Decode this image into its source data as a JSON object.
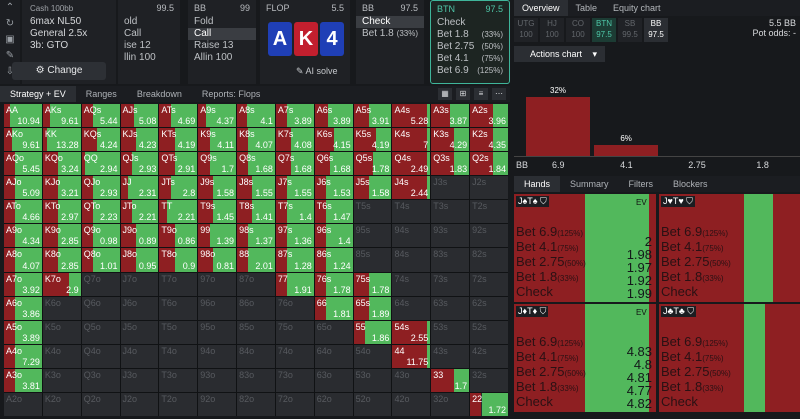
{
  "sidebar_icons": [
    "chevron-up-icon",
    "refresh-icon",
    "save-icon",
    "edit-icon",
    "export-icon"
  ],
  "game": {
    "title": "Cash 100",
    "title_unit": "bb",
    "lines": [
      "6max NL50",
      "General 2.5x",
      "3b: GTO"
    ],
    "change_label": "Change"
  },
  "panel_sb": {
    "pos": "",
    "stack": "99.5",
    "rows": [
      {
        "a": "old",
        "p": ""
      },
      {
        "a": "Call",
        "p": ""
      },
      {
        "a": "ise 12",
        "p": ""
      },
      {
        "a": "llin 100",
        "p": ""
      }
    ]
  },
  "panel_bb": {
    "pos": "BB",
    "stack": "99",
    "rows": [
      {
        "a": "Fold",
        "p": ""
      },
      {
        "a": "Call",
        "p": ""
      },
      {
        "a": "Raise 13",
        "p": ""
      },
      {
        "a": "Allin 100",
        "p": ""
      }
    ]
  },
  "flop": {
    "label": "FLOP",
    "pot": "5.5",
    "cards": [
      "A",
      "K",
      "4"
    ],
    "ai_label": "AI solve"
  },
  "panel_bb2": {
    "pos": "BB",
    "stack": "97.5",
    "rows": [
      {
        "a": "Check",
        "p": ""
      },
      {
        "a": "Bet 1.8",
        "p": "(33%)"
      }
    ]
  },
  "panel_btn": {
    "pos": "BTN",
    "stack": "97.5",
    "rows": [
      {
        "a": "Check",
        "p": ""
      },
      {
        "a": "Bet 1.8",
        "p": "(33%)"
      },
      {
        "a": "Bet 2.75",
        "p": "(50%)"
      },
      {
        "a": "Bet 4.1",
        "p": "(75%)"
      },
      {
        "a": "Bet 6.9",
        "p": "(125%)"
      }
    ]
  },
  "subnav": {
    "tabs": [
      "Strategy + EV",
      "Ranges",
      "Breakdown",
      "Reports: Flops"
    ]
  },
  "grid": [
    [
      [
        "AA",
        "10.94",
        0.15,
        0.85
      ],
      [
        "AKs",
        "9.61",
        0.2,
        0.8
      ],
      [
        "AQs",
        "5.44",
        0.3,
        0.7
      ],
      [
        "AJs",
        "5.08",
        0.35,
        0.65
      ],
      [
        "ATs",
        "4.69",
        0.3,
        0.7
      ],
      [
        "A9s",
        "4.37",
        0.2,
        0.8
      ],
      [
        "A8s",
        "4.1",
        0.25,
        0.75
      ],
      [
        "A7s",
        "3.89",
        0.3,
        0.7
      ],
      [
        "A6s",
        "3.89",
        0.35,
        0.65
      ],
      [
        "A5s",
        "3.91",
        0.4,
        0.6
      ],
      [
        "A4s",
        "5.28",
        0.9,
        0.1
      ],
      [
        "A3s",
        "3.87",
        0.5,
        0.5
      ],
      [
        "A2s",
        "3.96",
        0.6,
        0.4
      ]
    ],
    [
      [
        "AKo",
        "9.61",
        0.2,
        0.8
      ],
      [
        "KK",
        "13.28",
        0.1,
        0.9
      ],
      [
        "KQs",
        "4.24",
        0.4,
        0.6
      ],
      [
        "KJs",
        "4.23",
        0.4,
        0.6
      ],
      [
        "KTs",
        "4.19",
        0.4,
        0.6
      ],
      [
        "K9s",
        "4.11",
        0.3,
        0.7
      ],
      [
        "K8s",
        "4.07",
        0.3,
        0.7
      ],
      [
        "K7s",
        "4.08",
        0.4,
        0.6
      ],
      [
        "K6s",
        "4.15",
        0.5,
        0.5
      ],
      [
        "K5s",
        "4.19",
        0.6,
        0.4
      ],
      [
        "K4s",
        "7",
        0.9,
        0.1
      ],
      [
        "K3s",
        "4.29",
        0.6,
        0.4
      ],
      [
        "K2s",
        "4.35",
        0.6,
        0.4
      ]
    ],
    [
      [
        "AQo",
        "5.45",
        0.3,
        0.7
      ],
      [
        "KQo",
        "3.24",
        0.4,
        0.6
      ],
      [
        "QQ",
        "2.94",
        0.1,
        0.9
      ],
      [
        "QJs",
        "2.93",
        0.3,
        0.7
      ],
      [
        "QTs",
        "2.91",
        0.4,
        0.6
      ],
      [
        "Q9s",
        "1.7",
        0.3,
        0.7
      ],
      [
        "Q8s",
        "1.68",
        0.3,
        0.7
      ],
      [
        "Q7s",
        "1.68",
        0.4,
        0.6
      ],
      [
        "Q6s",
        "1.68",
        0.4,
        0.6
      ],
      [
        "Q5s",
        "1.78",
        0.5,
        0.5
      ],
      [
        "Q4s",
        "2.49",
        0.9,
        0.1
      ],
      [
        "Q3s",
        "1.83",
        0.6,
        0.4
      ],
      [
        "Q2s",
        "1.84",
        0.6,
        0.4
      ]
    ],
    [
      [
        "AJo",
        "5.09",
        0.3,
        0.7
      ],
      [
        "KJo",
        "3.21",
        0.4,
        0.6
      ],
      [
        "QJo",
        "2.93",
        0.3,
        0.7
      ],
      [
        "JJ",
        "2.31",
        0.2,
        0.8
      ],
      [
        "JTs",
        "2.8",
        0.3,
        0.7
      ],
      [
        "J9s",
        "1.58",
        0.4,
        0.6
      ],
      [
        "J8s",
        "1.55",
        0.4,
        0.6
      ],
      [
        "J7s",
        "1.55",
        0.3,
        0.7
      ],
      [
        "J6s",
        "1.53",
        0.3,
        0.7
      ],
      [
        "J5s",
        "1.58",
        0.4,
        0.6
      ],
      [
        "J4s",
        "2.44",
        0.9,
        0.1
      ],
      [
        "J3s",
        "",
        0,
        0
      ],
      [
        "J2s",
        "",
        0,
        0
      ]
    ],
    [
      [
        "ATo",
        "4.66",
        0.3,
        0.7
      ],
      [
        "KTo",
        "2.97",
        0.4,
        0.6
      ],
      [
        "QTo",
        "2.23",
        0.3,
        0.7
      ],
      [
        "JTo",
        "2.21",
        0.3,
        0.7
      ],
      [
        "TT",
        "2.21",
        0.2,
        0.8
      ],
      [
        "T9s",
        "1.45",
        0.4,
        0.6
      ],
      [
        "T8s",
        "1.41",
        0.4,
        0.6
      ],
      [
        "T7s",
        "1.4",
        0.3,
        0.7
      ],
      [
        "T6s",
        "1.47",
        0.3,
        0.7
      ],
      [
        "T5s",
        "",
        0,
        0
      ],
      [
        "T4s",
        "",
        0,
        0
      ],
      [
        "T3s",
        "",
        0,
        0
      ],
      [
        "T2s",
        "",
        0,
        0
      ]
    ],
    [
      [
        "A9o",
        "4.34",
        0.3,
        0.7
      ],
      [
        "K9o",
        "2.85",
        0.4,
        0.6
      ],
      [
        "Q9o",
        "0.98",
        0.3,
        0.7
      ],
      [
        "J9o",
        "0.89",
        0.4,
        0.6
      ],
      [
        "T9o",
        "0.86",
        0.4,
        0.6
      ],
      [
        "99",
        "1.39",
        0.3,
        0.7
      ],
      [
        "98s",
        "1.37",
        0.3,
        0.7
      ],
      [
        "97s",
        "1.36",
        0.3,
        0.7
      ],
      [
        "96s",
        "1.4",
        0.3,
        0.7
      ],
      [
        "95s",
        "",
        0,
        0
      ],
      [
        "94s",
        "",
        0,
        0
      ],
      [
        "93s",
        "",
        0,
        0
      ],
      [
        "92s",
        "",
        0,
        0
      ]
    ],
    [
      [
        "A8o",
        "4.07",
        0.3,
        0.7
      ],
      [
        "K8o",
        "2.85",
        0.4,
        0.6
      ],
      [
        "Q8o",
        "1.01",
        0.3,
        0.7
      ],
      [
        "J8o",
        "0.95",
        0.4,
        0.6
      ],
      [
        "T8o",
        "0.9",
        0.4,
        0.6
      ],
      [
        "98o",
        "0.81",
        0.4,
        0.6
      ],
      [
        "88",
        "2.01",
        0.3,
        0.7
      ],
      [
        "87s",
        "1.28",
        0.3,
        0.7
      ],
      [
        "86s",
        "1.24",
        0.3,
        0.7
      ],
      [
        "85s",
        "",
        0,
        0
      ],
      [
        "84s",
        "",
        0,
        0
      ],
      [
        "83s",
        "",
        0,
        0
      ],
      [
        "82s",
        "",
        0,
        0
      ]
    ],
    [
      [
        "A7o",
        "3.92",
        0.3,
        0.7
      ],
      [
        "K7o",
        "2.9",
        0.7,
        0.3
      ],
      [
        "Q7o",
        "",
        0,
        0
      ],
      [
        "J7o",
        "",
        0,
        0
      ],
      [
        "T7o",
        "",
        0,
        0
      ],
      [
        "97o",
        "",
        0,
        0
      ],
      [
        "87o",
        "",
        0,
        0
      ],
      [
        "77",
        "1.91",
        0.3,
        0.7
      ],
      [
        "76s",
        "1.78",
        0.3,
        0.7
      ],
      [
        "75s",
        "1.78",
        0.4,
        0.6
      ],
      [
        "74s",
        "",
        0,
        0
      ],
      [
        "73s",
        "",
        0,
        0
      ],
      [
        "72s",
        "",
        0,
        0
      ]
    ],
    [
      [
        "A6o",
        "3.86",
        0.3,
        0.7
      ],
      [
        "K6o",
        "",
        0,
        0
      ],
      [
        "Q6o",
        "",
        0,
        0
      ],
      [
        "J6o",
        "",
        0,
        0
      ],
      [
        "T6o",
        "",
        0,
        0
      ],
      [
        "96o",
        "",
        0,
        0
      ],
      [
        "86o",
        "",
        0,
        0
      ],
      [
        "76o",
        "",
        0,
        0
      ],
      [
        "66",
        "1.81",
        0.3,
        0.7
      ],
      [
        "65s",
        "1.89",
        0.4,
        0.6
      ],
      [
        "64s",
        "",
        0,
        0
      ],
      [
        "63s",
        "",
        0,
        0
      ],
      [
        "62s",
        "",
        0,
        0
      ]
    ],
    [
      [
        "A5o",
        "3.89",
        0.3,
        0.7
      ],
      [
        "K5o",
        "",
        0,
        0
      ],
      [
        "Q5o",
        "",
        0,
        0
      ],
      [
        "J5o",
        "",
        0,
        0
      ],
      [
        "T5o",
        "",
        0,
        0
      ],
      [
        "95o",
        "",
        0,
        0
      ],
      [
        "85o",
        "",
        0,
        0
      ],
      [
        "75o",
        "",
        0,
        0
      ],
      [
        "65o",
        "",
        0,
        0
      ],
      [
        "55",
        "1.86",
        0.3,
        0.7
      ],
      [
        "54s",
        "2.55",
        0.9,
        0.1
      ],
      [
        "53s",
        "",
        0,
        0
      ],
      [
        "52s",
        "",
        0,
        0
      ]
    ],
    [
      [
        "A4o",
        "7.29",
        0.3,
        0.7
      ],
      [
        "K4o",
        "",
        0,
        0
      ],
      [
        "Q4o",
        "",
        0,
        0
      ],
      [
        "J4o",
        "",
        0,
        0
      ],
      [
        "T4o",
        "",
        0,
        0
      ],
      [
        "94o",
        "",
        0,
        0
      ],
      [
        "84o",
        "",
        0,
        0
      ],
      [
        "74o",
        "",
        0,
        0
      ],
      [
        "64o",
        "",
        0,
        0
      ],
      [
        "54o",
        "",
        0,
        0
      ],
      [
        "44",
        "11.75",
        0.9,
        0.1
      ],
      [
        "43s",
        "",
        0,
        0
      ],
      [
        "42s",
        "",
        0,
        0
      ]
    ],
    [
      [
        "A3o",
        "3.81",
        0.3,
        0.7
      ],
      [
        "K3o",
        "",
        0,
        0
      ],
      [
        "Q3o",
        "",
        0,
        0
      ],
      [
        "J3o",
        "",
        0,
        0
      ],
      [
        "T3o",
        "",
        0,
        0
      ],
      [
        "93o",
        "",
        0,
        0
      ],
      [
        "83o",
        "",
        0,
        0
      ],
      [
        "73o",
        "",
        0,
        0
      ],
      [
        "63o",
        "",
        0,
        0
      ],
      [
        "53o",
        "",
        0,
        0
      ],
      [
        "43o",
        "",
        0,
        0
      ],
      [
        "33",
        "1.7",
        0.6,
        0.4
      ],
      [
        "32s",
        "",
        0,
        0
      ]
    ],
    [
      [
        "A2o",
        "",
        0,
        0
      ],
      [
        "K2o",
        "",
        0,
        0
      ],
      [
        "Q2o",
        "",
        0,
        0
      ],
      [
        "J2o",
        "",
        0,
        0
      ],
      [
        "T2o",
        "",
        0,
        0
      ],
      [
        "92o",
        "",
        0,
        0
      ],
      [
        "82o",
        "",
        0,
        0
      ],
      [
        "72o",
        "",
        0,
        0
      ],
      [
        "62o",
        "",
        0,
        0
      ],
      [
        "52o",
        "",
        0,
        0
      ],
      [
        "42o",
        "",
        0,
        0
      ],
      [
        "32o",
        "",
        0,
        0
      ],
      [
        "22",
        "1.72",
        0.3,
        0.7
      ]
    ]
  ],
  "right_tabs": [
    "Overview",
    "Table",
    "Equity chart"
  ],
  "positions": [
    {
      "pos": "UTG",
      "stack": "100",
      "state": ""
    },
    {
      "pos": "HJ",
      "stack": "100",
      "state": ""
    },
    {
      "pos": "CO",
      "stack": "100",
      "state": ""
    },
    {
      "pos": "BTN",
      "stack": "97.5",
      "state": "active"
    },
    {
      "pos": "SB",
      "stack": "99.5",
      "state": ""
    },
    {
      "pos": "BB",
      "stack": "97.5",
      "state": "cur"
    }
  ],
  "pot": {
    "value": "5.5 BB",
    "odds_label": "Pot odds:",
    "odds_value": "-"
  },
  "actions_chart_label": "Actions chart",
  "chart_data": {
    "type": "bar",
    "categories": [
      "6.9",
      "4.1",
      "2.75",
      "1.8"
    ],
    "values": [
      32,
      6,
      0,
      0
    ],
    "data_labels": [
      "32%",
      "6%",
      "",
      ""
    ],
    "axis_prefix": "BB"
  },
  "hand_tabs": [
    "Hands",
    "Summary",
    "Filters",
    "Blockers"
  ],
  "combos": [
    {
      "cards": "J♠T♠",
      "ev_label": "EV",
      "green": 0.45,
      "acts": [
        [
          "Bet 6.9",
          "(125%)"
        ],
        [
          "Bet 4.1",
          "(75%)"
        ],
        [
          "Bet 2.75",
          "(50%)"
        ],
        [
          "Bet 1.8",
          "(33%)"
        ],
        [
          "Check",
          ""
        ]
      ],
      "vals": [
        "2",
        "1.98",
        "1.97",
        "1.92",
        "1.99"
      ]
    },
    {
      "cards": "J♥T♥",
      "ev_label": "",
      "green": 0.2,
      "acts": [
        [
          "Bet 6.9",
          "(125%)"
        ],
        [
          "Bet 4.1",
          "(75%)"
        ],
        [
          "Bet 2.75",
          "(50%)"
        ],
        [
          "Bet 1.8",
          "(33%)"
        ],
        [
          "Check",
          ""
        ]
      ],
      "vals": []
    },
    {
      "cards": "J♦T♦",
      "ev_label": "EV",
      "green": 0.45,
      "acts": [
        [
          "Bet 6.9",
          "(125%)"
        ],
        [
          "Bet 4.1",
          "(75%)"
        ],
        [
          "Bet 2.75",
          "(50%)"
        ],
        [
          "Bet 1.8",
          "(33%)"
        ],
        [
          "Check",
          ""
        ]
      ],
      "vals": [
        "4.83",
        "4.8",
        "4.81",
        "4.77",
        "4.82"
      ]
    },
    {
      "cards": "J♣T♣",
      "ev_label": "",
      "green": 0.15,
      "acts": [
        [
          "Bet 6.9",
          "(125%)"
        ],
        [
          "Bet 4.1",
          "(75%)"
        ],
        [
          "Bet 2.75",
          "(50%)"
        ],
        [
          "Bet 1.8",
          "(33%)"
        ],
        [
          "Check",
          ""
        ]
      ],
      "vals": []
    }
  ]
}
